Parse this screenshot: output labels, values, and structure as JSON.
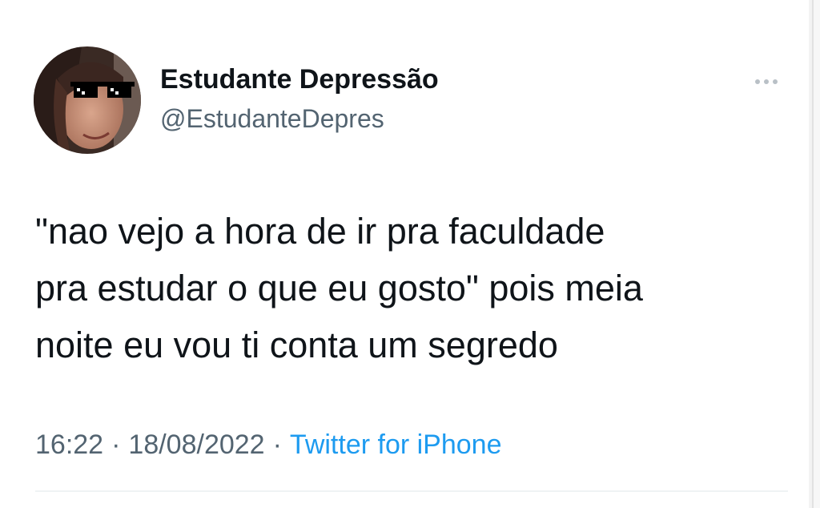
{
  "tweet": {
    "author": {
      "display_name": "Estudante Depressão",
      "handle": "@EstudanteDepres",
      "avatar_icon": "profile-photo-with-pixel-sunglasses"
    },
    "text": "\"nao vejo a hora de ir pra faculdade\npra estudar o que eu gosto\" pois meia\nnoite eu vou ti conta um segredo",
    "time": "16:22",
    "separator": "·",
    "date": "18/08/2022",
    "source": "Twitter for iPhone",
    "more_icon": "more-options-icon"
  },
  "colors": {
    "text_primary": "#0f1419",
    "text_secondary": "#536471",
    "link": "#1d9bf0",
    "divider": "#eff3f4"
  }
}
